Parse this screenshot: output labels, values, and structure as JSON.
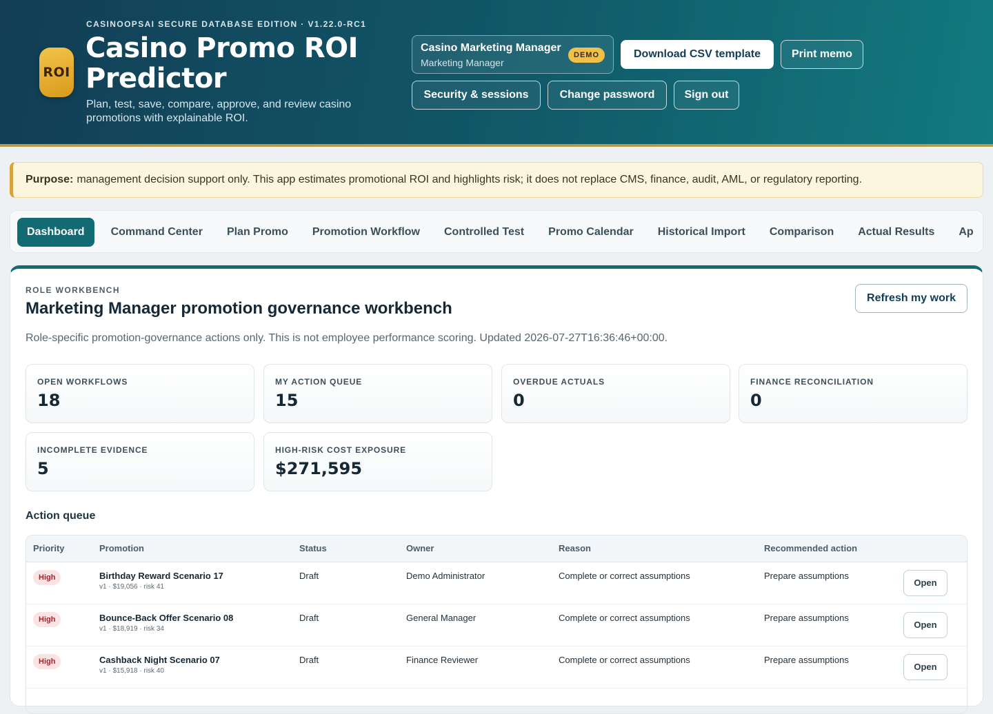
{
  "header": {
    "edition": "CASINOOPSAI SECURE DATABASE EDITION · V1.22.0-RC1",
    "logo_text": "ROI",
    "title": "Casino Promo ROI Predictor",
    "subtitle": "Plan, test, save, compare, approve, and review casino promotions with explainable ROI.",
    "user_name": "Casino Marketing Manager",
    "user_role": "Marketing Manager",
    "demo_badge": "DEMO",
    "download_csv": "Download CSV template",
    "print_memo": "Print memo",
    "security_sessions": "Security & sessions",
    "change_password": "Change password",
    "sign_out": "Sign out"
  },
  "purpose": {
    "label": "Purpose:",
    "text": "management decision support only. This app estimates promotional ROI and highlights risk; it does not replace CMS, finance, audit, AML, or regulatory reporting."
  },
  "tabs": [
    "Dashboard",
    "Command Center",
    "Plan Promo",
    "Promotion Workflow",
    "Controlled Test",
    "Promo Calendar",
    "Historical Import",
    "Comparison",
    "Actual Results",
    "Ap"
  ],
  "workbench": {
    "eyebrow": "ROLE WORKBENCH",
    "title": "Marketing Manager promotion governance workbench",
    "refresh": "Refresh my work",
    "description": "Role-specific promotion-governance actions only. This is not employee performance scoring. Updated 2026-07-27T16:36:46+00:00.",
    "metrics": [
      {
        "label": "OPEN WORKFLOWS",
        "value": "18"
      },
      {
        "label": "MY ACTION QUEUE",
        "value": "15"
      },
      {
        "label": "OVERDUE ACTUALS",
        "value": "0"
      },
      {
        "label": "FINANCE RECONCILIATION",
        "value": "0"
      },
      {
        "label": "INCOMPLETE EVIDENCE",
        "value": "5"
      },
      {
        "label": "HIGH-RISK COST EXPOSURE",
        "value": "$271,595"
      }
    ],
    "queue_title": "Action queue",
    "columns": [
      "Priority",
      "Promotion",
      "Status",
      "Owner",
      "Reason",
      "Recommended action"
    ],
    "open_label": "Open",
    "rows": [
      {
        "priority": "High",
        "promotion": "Birthday Reward Scenario 17",
        "meta": "v1 · $19,056 · risk 41",
        "status": "Draft",
        "owner": "Demo Administrator",
        "reason": "Complete or correct assumptions",
        "action": "Prepare assumptions"
      },
      {
        "priority": "High",
        "promotion": "Bounce-Back Offer Scenario 08",
        "meta": "v1 · $18,919 · risk 34",
        "status": "Draft",
        "owner": "General Manager",
        "reason": "Complete or correct assumptions",
        "action": "Prepare assumptions"
      },
      {
        "priority": "High",
        "promotion": "Cashback Night Scenario 07",
        "meta": "v1 · $15,918 · risk 40",
        "status": "Draft",
        "owner": "Finance Reviewer",
        "reason": "Complete or correct assumptions",
        "action": "Prepare assumptions"
      },
      {
        "priority": "",
        "promotion": "",
        "meta": "",
        "status": "",
        "owner": "",
        "reason": "",
        "action": ""
      }
    ]
  }
}
